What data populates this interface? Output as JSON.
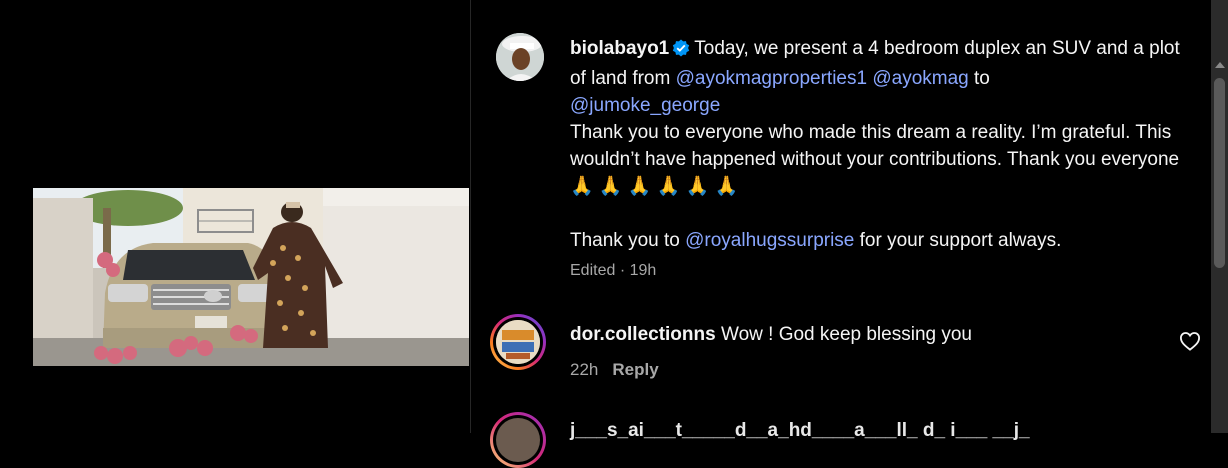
{
  "post": {
    "username": "biolabayo1",
    "caption_part1": "Today, we present a 4 bedroom duplex an SUV and a plot of land from ",
    "mention1": "@ayokmagproperties1",
    "mention2": "@ayokmag",
    "to_word": " to",
    "mention3": "@jumoke_george",
    "caption_part2": "Thank you to everyone who made this dream a reality. I’m grateful. This wouldn’t have happened without your contributions. Thank you everyone",
    "emojis": "🙏 🙏 🙏 🙏 🙏 🙏",
    "thanks_prefix": "Thank you to ",
    "mention4": "@royalhugssurprise",
    "thanks_suffix": " for your support always.",
    "edited": "Edited",
    "time": "19h"
  },
  "comments": [
    {
      "username": "dor.collectionns",
      "text": "Wow ! God keep blessing you",
      "time": "22h",
      "reply_label": "Reply"
    },
    {
      "partial_text": "j___s_ai___t_____d__a_hd____a___ll_ d_ i___ __j_"
    }
  ],
  "colors": {
    "mention": "#8aa7ff",
    "muted": "#a8a8a8",
    "verified": "#0095f6"
  }
}
